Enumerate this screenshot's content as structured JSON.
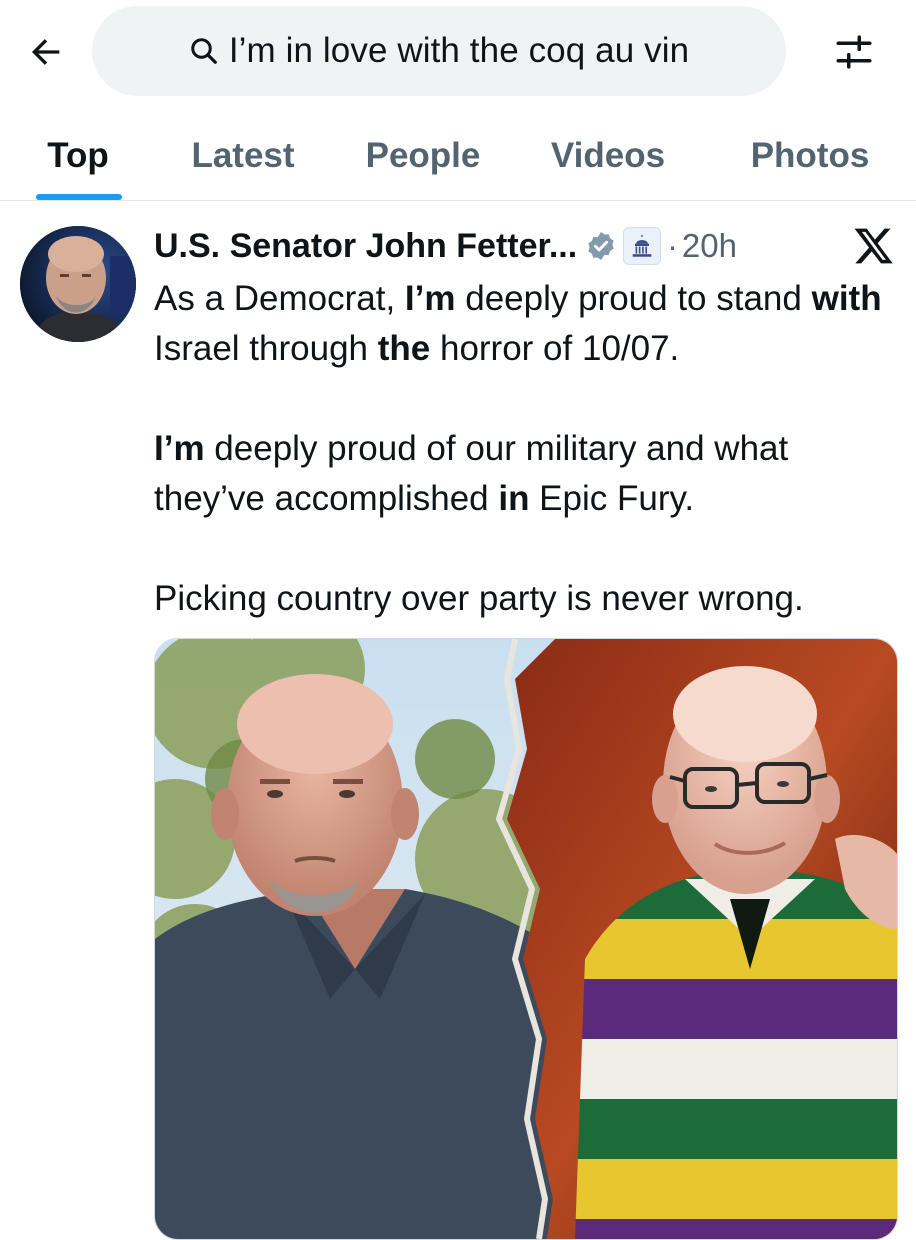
{
  "search": {
    "query": "I’m in love with the coq au vin"
  },
  "tabs": [
    {
      "label": "Top",
      "active": true
    },
    {
      "label": "Latest",
      "active": false
    },
    {
      "label": "People",
      "active": false
    },
    {
      "label": "Videos",
      "active": false
    },
    {
      "label": "Photos",
      "active": false
    }
  ],
  "tweet": {
    "author": "U.S. Senator John Fetter...",
    "separator": "·",
    "time": "20h",
    "paragraphs": [
      [
        {
          "t": "As a Democrat, ",
          "b": false
        },
        {
          "t": "I’m",
          "b": true
        },
        {
          "t": " deeply proud to stand ",
          "b": false
        },
        {
          "t": "with",
          "b": true
        },
        {
          "t": " Israel through ",
          "b": false
        },
        {
          "t": "the",
          "b": true
        },
        {
          "t": " horror of 10/07.",
          "b": false
        }
      ],
      [
        {
          "t": "I’m",
          "b": true
        },
        {
          "t": " deeply proud of our military and what they’ve accomplished ",
          "b": false
        },
        {
          "t": "in",
          "b": true
        },
        {
          "t": " Epic Fury.",
          "b": false
        }
      ],
      [
        {
          "t": "Picking country over party is never wrong.",
          "b": false
        }
      ]
    ]
  },
  "icons": {
    "back": "arrow-left-icon",
    "search": "search-icon",
    "filter": "sliders-icon",
    "verified": "verified-badge-icon",
    "affiliation": "capitol-icon",
    "brand": "x-logo-icon"
  },
  "colors": {
    "accent": "#1d9bf0",
    "text": "#0f1419",
    "muted": "#536471",
    "search_bg": "#eff3f4",
    "verified_badge": "#829aab"
  }
}
